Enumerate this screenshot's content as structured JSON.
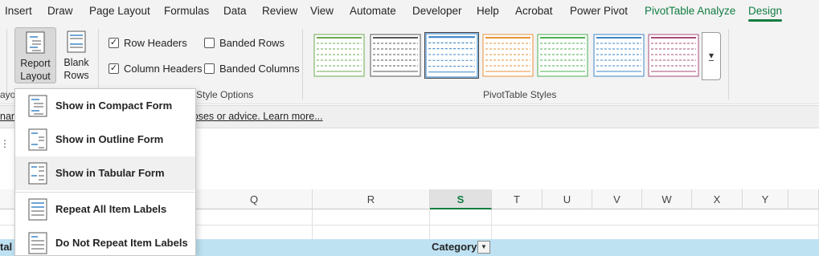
{
  "tabs": [
    {
      "label": "Insert",
      "style": "normal"
    },
    {
      "label": "Draw",
      "style": "normal"
    },
    {
      "label": "Page Layout",
      "style": "normal"
    },
    {
      "label": "Formulas",
      "style": "normal"
    },
    {
      "label": "Data",
      "style": "normal"
    },
    {
      "label": "Review",
      "style": "normal"
    },
    {
      "label": "View",
      "style": "normal"
    },
    {
      "label": "Automate",
      "style": "normal"
    },
    {
      "label": "Developer",
      "style": "normal"
    },
    {
      "label": "Help",
      "style": "normal"
    },
    {
      "label": "Acrobat",
      "style": "normal"
    },
    {
      "label": "Power Pivot",
      "style": "normal"
    },
    {
      "label": "PivotTable Analyze",
      "style": "contextual"
    },
    {
      "label": "Design",
      "style": "active"
    }
  ],
  "ribbon": {
    "report_layout": {
      "line1": "Report",
      "line2": "Layout ⌄"
    },
    "blank_rows": {
      "line1": "Blank",
      "line2": "Rows ⌄"
    },
    "layout_group_label": "ayout",
    "checkboxes": [
      {
        "label": "Row Headers",
        "checked": true
      },
      {
        "label": "Column Headers",
        "checked": true
      },
      {
        "label": "Banded Rows",
        "checked": false
      },
      {
        "label": "Banded Columns",
        "checked": false
      }
    ],
    "style_options_label": "Style Options",
    "pivot_styles_label": "PivotTable Styles",
    "style_swatches": [
      {
        "color": "#6aa84f",
        "selected": false
      },
      {
        "color": "#555555",
        "selected": false
      },
      {
        "color": "#3d85c6",
        "selected": true
      },
      {
        "color": "#e69138",
        "selected": false
      },
      {
        "color": "#4caf50",
        "selected": false
      },
      {
        "color": "#3d85c6",
        "selected": false
      },
      {
        "color": "#a64d79",
        "selected": false
      }
    ],
    "more_icon": "more-styles-icon"
  },
  "infobar": {
    "text": "nan and not for professional or trading purposes or advice. Learn more..."
  },
  "columns": [
    {
      "label": "Q",
      "selected": false
    },
    {
      "label": "R",
      "selected": false
    },
    {
      "label": "S",
      "selected": true
    },
    {
      "label": "T",
      "selected": false
    },
    {
      "label": "U",
      "selected": false
    },
    {
      "label": "V",
      "selected": false
    },
    {
      "label": "W",
      "selected": false
    },
    {
      "label": "X",
      "selected": false
    },
    {
      "label": "Y",
      "selected": false
    }
  ],
  "pivot": {
    "total_label": "tal",
    "category_label": "Category"
  },
  "menu": {
    "items": [
      {
        "label": "Show in Compact Form",
        "icon": "compact-form-icon"
      },
      {
        "label": "Show in Outline Form",
        "icon": "outline-form-icon"
      },
      {
        "label": "Show in Tabular Form",
        "icon": "tabular-form-icon"
      },
      {
        "label": "Repeat All Item Labels",
        "icon": "repeat-labels-icon"
      },
      {
        "label": "Do Not Repeat Item Labels",
        "icon": "no-repeat-labels-icon"
      }
    ]
  },
  "colors": {
    "accent": "#107c41",
    "pivot_header": "#bfe2f3"
  }
}
